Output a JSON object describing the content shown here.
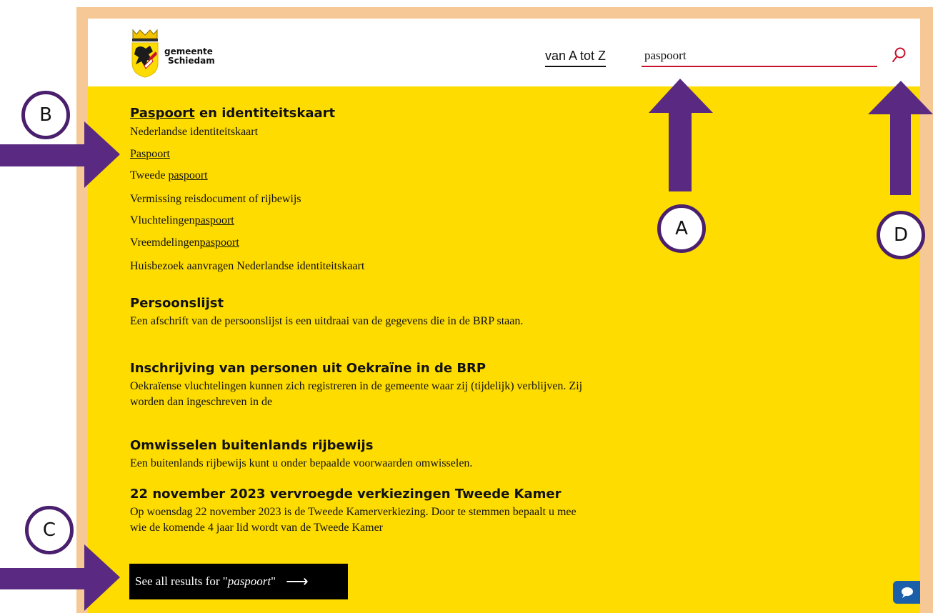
{
  "site": {
    "logo_line1": "gemeente",
    "logo_line2": "Schiedam"
  },
  "header": {
    "atoz_label": "van A tot Z",
    "search_value": "paspoort",
    "search_icon": "search-icon"
  },
  "results": {
    "group1": {
      "title_highlight": "Paspoort",
      "title_rest": " en identiteitskaart",
      "links": [
        {
          "pre": "Nederlandse identiteitskaart",
          "hl": "",
          "post": ""
        },
        {
          "pre": "",
          "hl": "Paspoort",
          "post": ""
        },
        {
          "pre": "Tweede ",
          "hl": "paspoort",
          "post": ""
        },
        {
          "pre": "Vermissing reisdocument of rijbewijs",
          "hl": "",
          "post": ""
        },
        {
          "pre": "Vluchtelingen",
          "hl": "paspoort",
          "post": ""
        },
        {
          "pre": "Vreemdelingen",
          "hl": "paspoort",
          "post": ""
        },
        {
          "pre": "Huisbezoek aanvragen Nederlandse identiteitskaart",
          "hl": "",
          "post": ""
        }
      ]
    },
    "items": [
      {
        "title": "Persoonslijst",
        "desc": "Een afschrift van de persoonslijst is een uitdraai van de gegevens die in de BRP staan."
      },
      {
        "title": "Inschrijving van personen uit Oekraïne in de BRP",
        "desc": "Oekraïense vluchtelingen kunnen zich registreren in de gemeente waar zij (tijdelijk) verblijven. Zij worden dan ingeschreven in de"
      },
      {
        "title": "Omwisselen buitenlands rijbewijs",
        "desc": "Een buitenlands rijbewijs kunt u onder bepaalde voorwaarden omwisselen."
      },
      {
        "title": "22 november 2023 vervroegde verkiezingen Tweede Kamer",
        "desc": "Op woensdag 22 november 2023 is de Tweede Kamerverkiezing. Door te stemmen bepaalt u mee wie de komende 4 jaar lid wordt van de Tweede Kamer"
      }
    ],
    "all_results_prefix": "See all results for \"",
    "all_results_term": "paspoort",
    "all_results_suffix": "\"",
    "all_results_arrow": "⟶"
  },
  "chat": {
    "icon": "chat-bubble-icon"
  },
  "annotations": {
    "markers": [
      "A",
      "B",
      "C",
      "D"
    ],
    "color": "#5a2a82"
  }
}
